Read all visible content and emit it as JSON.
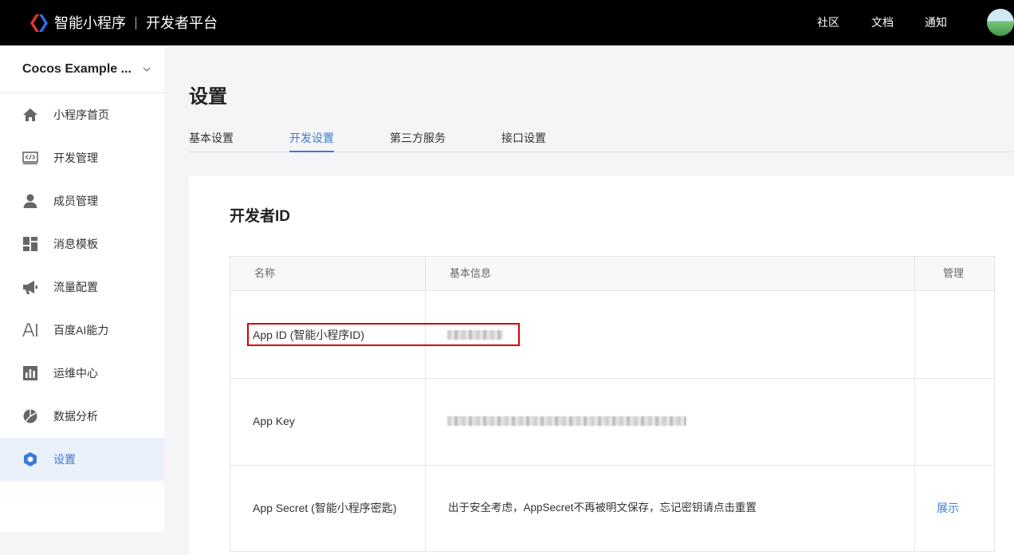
{
  "header": {
    "brand": "智能小程序",
    "platform": "开发者平台",
    "nav": [
      "社区",
      "文档",
      "通知"
    ]
  },
  "sidebar": {
    "app_name": "Cocos Example ...",
    "items": [
      {
        "label": "小程序首页",
        "icon": "home-icon"
      },
      {
        "label": "开发管理",
        "icon": "code-icon"
      },
      {
        "label": "成员管理",
        "icon": "user-icon"
      },
      {
        "label": "消息模板",
        "icon": "template-icon"
      },
      {
        "label": "流量配置",
        "icon": "megaphone-icon"
      },
      {
        "label": "百度AI能力",
        "icon": "ai-icon"
      },
      {
        "label": "运维中心",
        "icon": "chart-bars-icon"
      },
      {
        "label": "数据分析",
        "icon": "pie-chart-icon"
      },
      {
        "label": "设置",
        "icon": "settings-icon",
        "active": true
      }
    ]
  },
  "main": {
    "title": "设置",
    "tabs": [
      "基本设置",
      "开发设置",
      "第三方服务",
      "接口设置"
    ],
    "active_tab": "开发设置",
    "section_title": "开发者ID",
    "table": {
      "headers": [
        "名称",
        "基本信息",
        "管理"
      ],
      "rows": [
        {
          "name": "App ID (智能小程序ID)",
          "info": "",
          "action": ""
        },
        {
          "name": "App Key",
          "info": "",
          "action": ""
        },
        {
          "name": "App Secret (智能小程序密匙)",
          "info": "出于安全考虑，AppSecret不再被明文保存，忘记密钥请点击重置",
          "action": "展示"
        }
      ]
    }
  },
  "colors": {
    "accent": "#3c7bd5",
    "highlight_border": "#d40000",
    "topbar": "#000000"
  }
}
